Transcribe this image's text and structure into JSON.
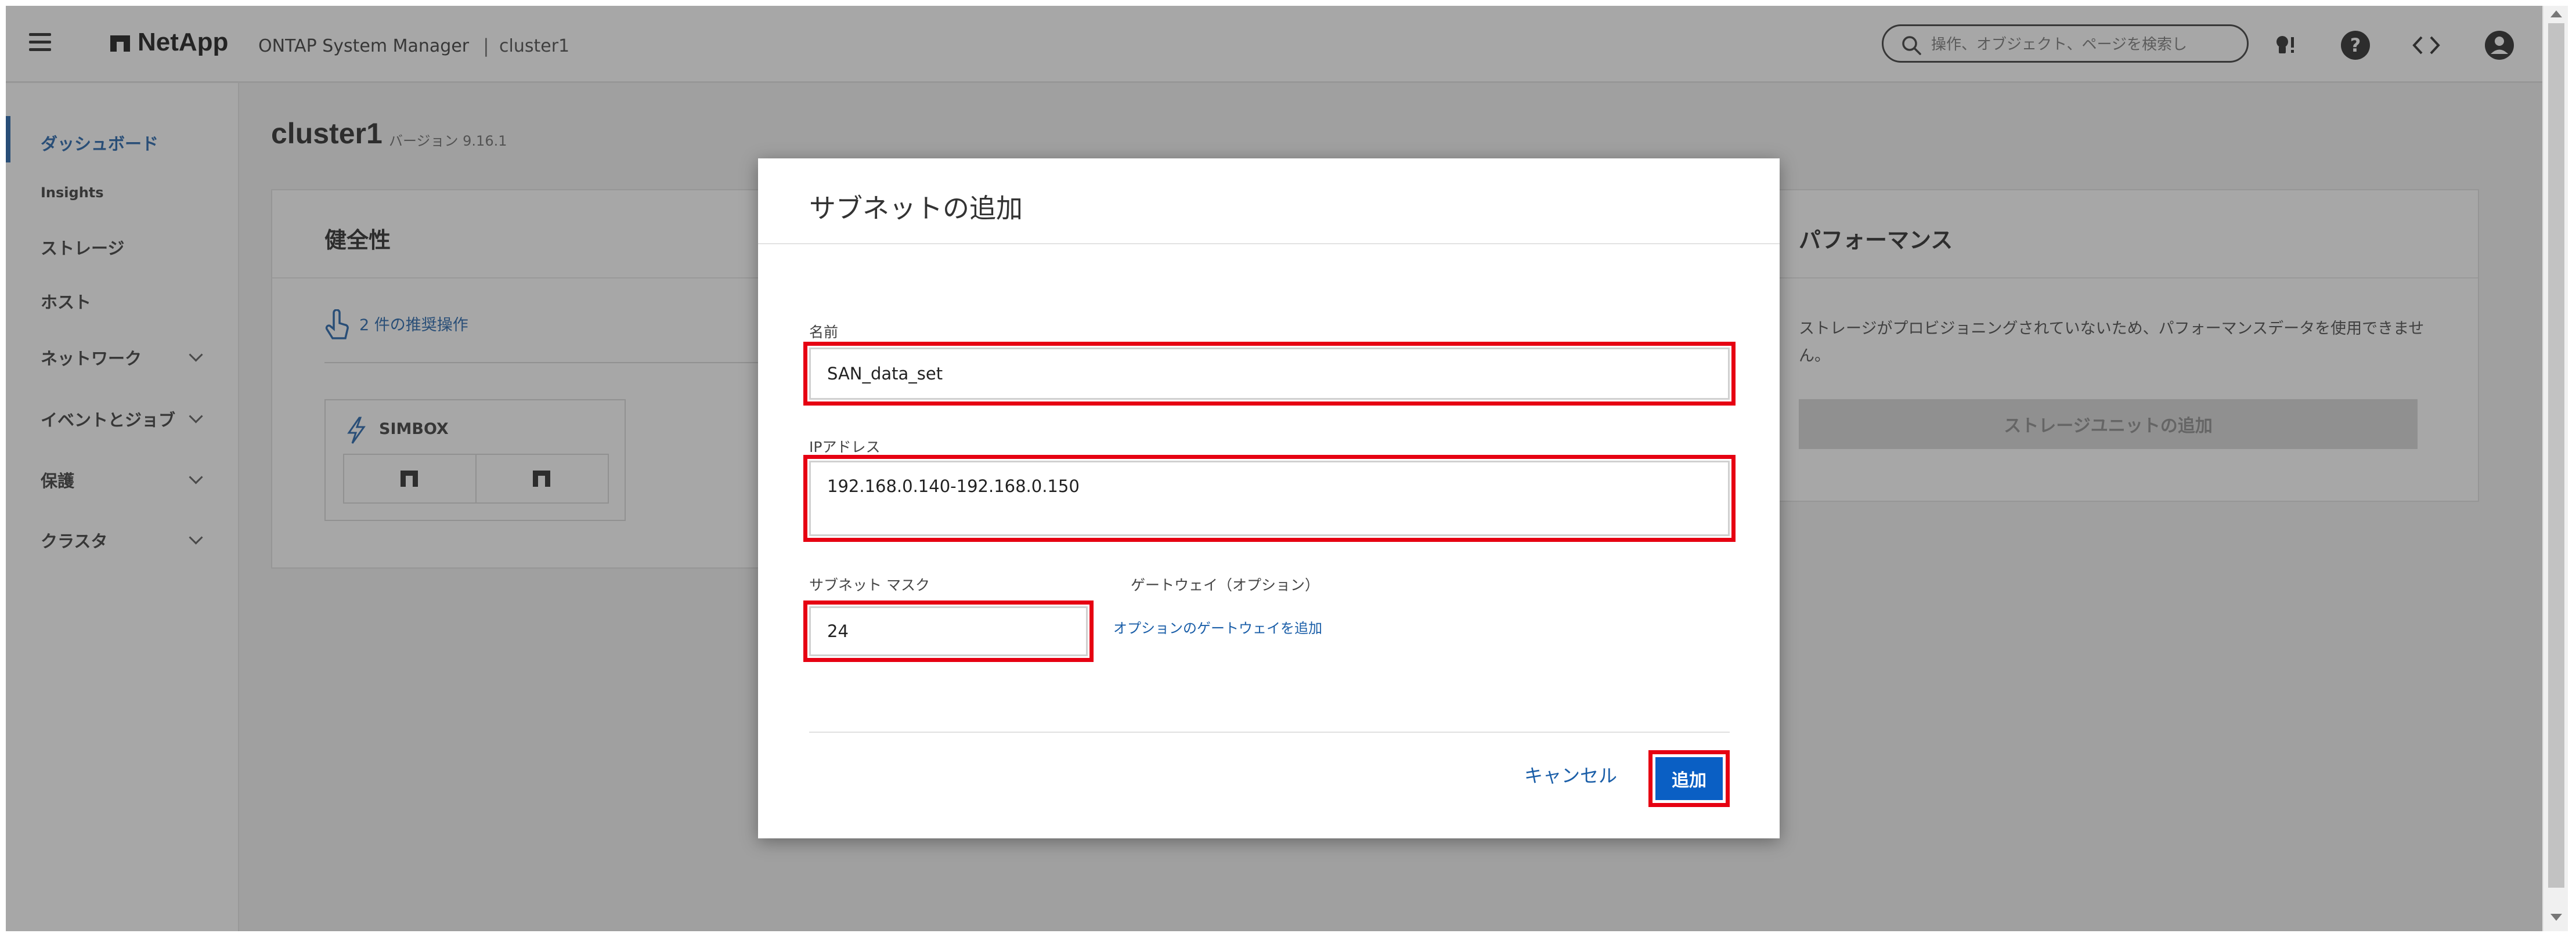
{
  "topbar": {
    "brand": "NetApp",
    "product": "ONTAP System Manager",
    "separator": "|",
    "cluster": "cluster1",
    "search_placeholder": "操作、オブジェクト、ページを検索し"
  },
  "sidebar": {
    "items": [
      {
        "label": "ダッシュボード",
        "active": true
      },
      {
        "label": "Insights"
      },
      {
        "label": "ストレージ"
      },
      {
        "label": "ホスト"
      },
      {
        "label": "ネットワーク",
        "expandable": true
      },
      {
        "label": "イベントとジョブ",
        "expandable": true
      },
      {
        "label": "保護",
        "expandable": true
      },
      {
        "label": "クラスタ",
        "expandable": true
      }
    ]
  },
  "main": {
    "title": "cluster1",
    "version": "バージョン 9.16.1",
    "health": {
      "title": "健全性",
      "recommendation": "2 件の推奨操作",
      "node_group": "SIMBOX"
    },
    "performance": {
      "title": "パフォーマンス",
      "message": "ストレージがプロビジョニングされていないため、パフォーマンスデータを使用できません。",
      "button": "ストレージユニットの追加"
    }
  },
  "modal": {
    "title": "サブネットの追加",
    "name_label": "名前",
    "name_value": "SAN_data_set",
    "ip_label": "IPアドレス",
    "ip_value": "192.168.0.140-192.168.0.150",
    "mask_label": "サブネット マスク",
    "mask_value": "24",
    "gateway_label": "ゲートウェイ（オプション）",
    "gateway_link": "オプションのゲートウェイを追加",
    "cancel": "キャンセル",
    "add": "追加"
  },
  "colors": {
    "accent": "#0a5fc4",
    "link": "#1a5ea8",
    "highlight": "#e60012"
  }
}
